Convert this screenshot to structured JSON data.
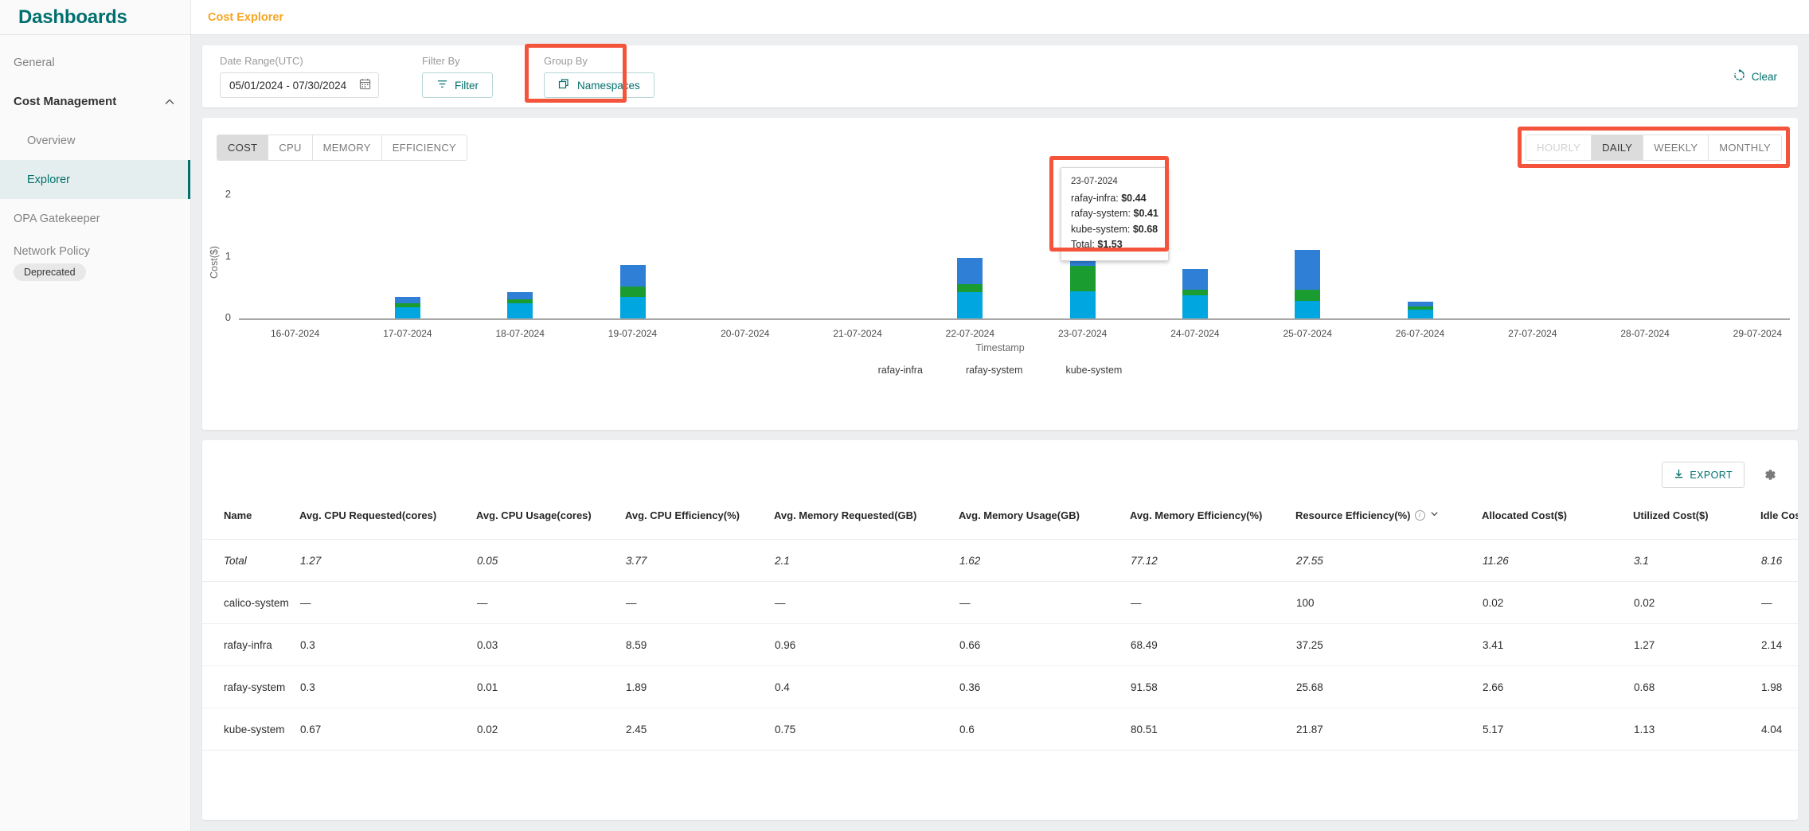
{
  "sidebar": {
    "title": "Dashboards",
    "items": [
      {
        "label": "General",
        "type": "item",
        "active": false
      },
      {
        "label": "Cost Management",
        "type": "group",
        "active": false
      },
      {
        "label": "Overview",
        "type": "sub",
        "active": false
      },
      {
        "label": "Explorer",
        "type": "sub",
        "active": true
      },
      {
        "label": "OPA Gatekeeper",
        "type": "item",
        "active": false
      },
      {
        "label": "Network Policy",
        "type": "item",
        "active": false
      }
    ],
    "network_policy_badge": "Deprecated"
  },
  "breadcrumb": {
    "current": "Cost Explorer"
  },
  "filters": {
    "date_range_label": "Date Range(UTC)",
    "date_range_value": "05/01/2024  -  07/30/2024",
    "calendar_icon": "calendar-icon",
    "filter_by_label": "Filter By",
    "filter_button": "Filter",
    "filter_icon": "filter-icon",
    "group_by_label": "Group By",
    "group_by_button": "Namespaces",
    "group_by_icon": "layers-icon",
    "clear_label": "Clear",
    "clear_icon": "restore-icon"
  },
  "chart_tabs": [
    {
      "label": "COST",
      "selected": true
    },
    {
      "label": "CPU",
      "selected": false
    },
    {
      "label": "MEMORY",
      "selected": false
    },
    {
      "label": "EFFICIENCY",
      "selected": false
    }
  ],
  "granularity": [
    {
      "label": "HOURLY",
      "selected": false,
      "disabled": true
    },
    {
      "label": "DAILY",
      "selected": true,
      "disabled": false
    },
    {
      "label": "WEEKLY",
      "selected": false,
      "disabled": false
    },
    {
      "label": "MONTHLY",
      "selected": false,
      "disabled": false
    }
  ],
  "tooltip": {
    "date": "23-07-2024",
    "rows": [
      {
        "label": "rafay-infra:",
        "value": "$0.44"
      },
      {
        "label": "rafay-system:",
        "value": "$0.41"
      },
      {
        "label": "kube-system:",
        "value": "$0.68"
      },
      {
        "label": "Total:",
        "value": "$1.53"
      }
    ]
  },
  "chart_data": {
    "type": "bar",
    "stacked": true,
    "title": "",
    "xlabel": "Timestamp",
    "ylabel": "Cost($)",
    "ylim": [
      0,
      2.2
    ],
    "yticks": [
      0,
      1,
      2
    ],
    "grid": false,
    "legend_position": "bottom",
    "categories": [
      "16-07-2024",
      "17-07-2024",
      "18-07-2024",
      "19-07-2024",
      "20-07-2024",
      "21-07-2024",
      "22-07-2024",
      "23-07-2024",
      "24-07-2024",
      "25-07-2024",
      "26-07-2024",
      "27-07-2024",
      "28-07-2024",
      "29-07-2024"
    ],
    "series": [
      {
        "name": "rafay-infra",
        "color": "#00a6e0",
        "values": [
          0,
          0.18,
          0.24,
          0.35,
          0,
          0,
          0.42,
          0.44,
          0.38,
          0.28,
          0.14,
          0,
          0,
          0
        ]
      },
      {
        "name": "rafay-system",
        "color": "#1a9c31",
        "values": [
          0,
          0.07,
          0.07,
          0.16,
          0,
          0,
          0.14,
          0.41,
          0.08,
          0.18,
          0.05,
          0,
          0,
          0
        ]
      },
      {
        "name": "kube-system",
        "color": "#2f7fd6",
        "values": [
          0,
          0.1,
          0.11,
          0.35,
          0,
          0,
          0.42,
          0.68,
          0.34,
          0.65,
          0.08,
          0,
          0,
          0
        ]
      }
    ]
  },
  "table": {
    "export_label": "EXPORT",
    "export_icon": "download-icon",
    "settings_icon": "gear-icon",
    "columns": [
      "Name",
      "Avg. CPU Requested(cores)",
      "Avg. CPU Usage(cores)",
      "Avg. CPU Efficiency(%)",
      "Avg. Memory Requested(GB)",
      "Avg. Memory Usage(GB)",
      "Avg. Memory Efficiency(%)",
      "Resource Efficiency(%)",
      "Allocated Cost($)",
      "Utilized Cost($)",
      "Idle Cost($)"
    ],
    "sorted_column": "Resource Efficiency(%)",
    "sort_icon": "chevron-down-icon",
    "rows": [
      {
        "name": "Total",
        "total": true,
        "cells": [
          "1.27",
          "0.05",
          "3.77",
          "2.1",
          "1.62",
          "77.12",
          "27.55",
          "11.26",
          "3.1",
          "8.16"
        ]
      },
      {
        "name": "calico-system",
        "total": false,
        "cells": [
          "—",
          "—",
          "—",
          "—",
          "—",
          "—",
          "100",
          "0.02",
          "0.02",
          "—"
        ]
      },
      {
        "name": "rafay-infra",
        "total": false,
        "cells": [
          "0.3",
          "0.03",
          "8.59",
          "0.96",
          "0.66",
          "68.49",
          "37.25",
          "3.41",
          "1.27",
          "2.14"
        ]
      },
      {
        "name": "rafay-system",
        "total": false,
        "cells": [
          "0.3",
          "0.01",
          "1.89",
          "0.4",
          "0.36",
          "91.58",
          "25.68",
          "2.66",
          "0.68",
          "1.98"
        ]
      },
      {
        "name": "kube-system",
        "total": false,
        "cells": [
          "0.67",
          "0.02",
          "2.45",
          "0.75",
          "0.6",
          "80.51",
          "21.87",
          "5.17",
          "1.13",
          "4.04"
        ]
      }
    ]
  },
  "colors": {
    "brand_teal": "#00706e",
    "breadcrumb_orange": "#f5a623",
    "highlight_red": "#f4543c",
    "series_rafay_infra": "#00a6e0",
    "series_rafay_system": "#1a9c31",
    "series_kube_system": "#2f7fd6"
  }
}
